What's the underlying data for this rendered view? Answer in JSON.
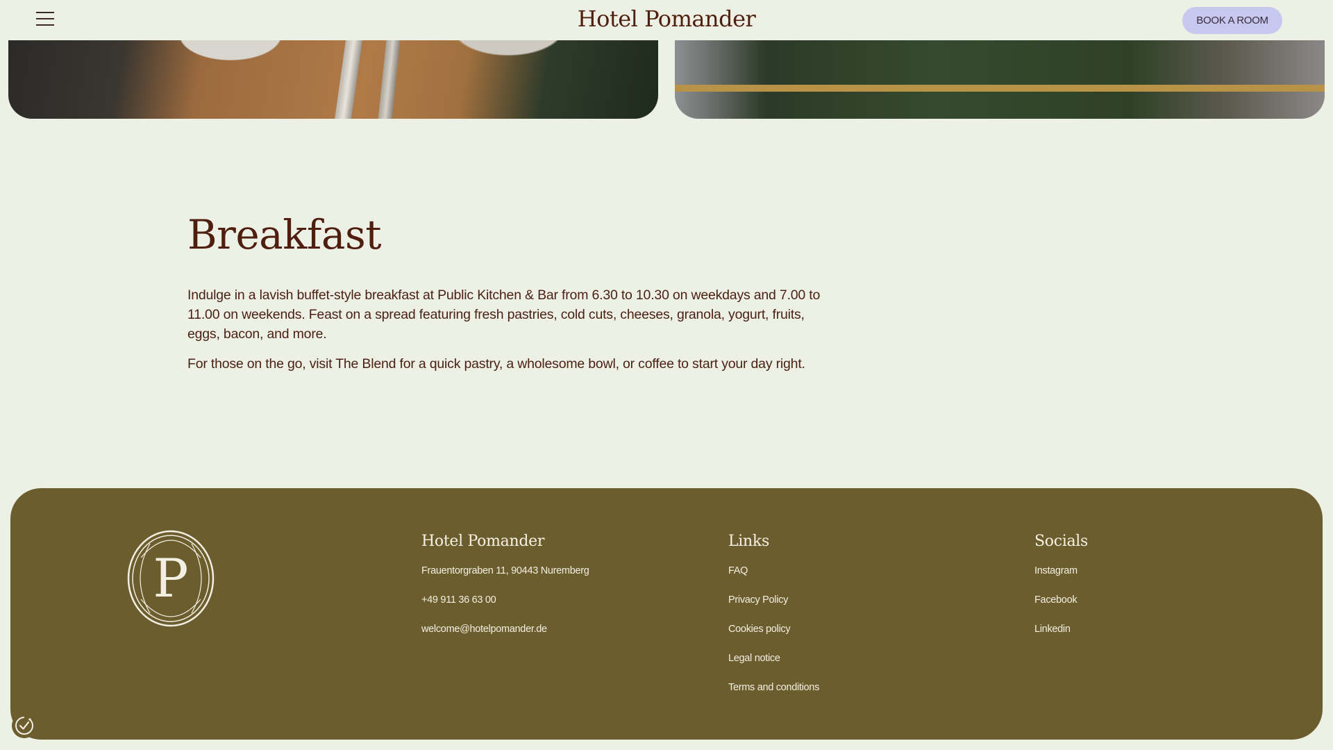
{
  "header": {
    "brand": "Hotel Pomander",
    "book_label": "BOOK A ROOM"
  },
  "section": {
    "title": "Breakfast",
    "paragraph1": "Indulge in a lavish buffet-style breakfast at Public Kitchen & Bar from 6.30 to 10.30 on weekdays and 7.00 to 11.00 on weekends. Feast on a spread featuring fresh pastries, cold cuts, cheeses, granola, yogurt, fruits, eggs, bacon, and more.",
    "paragraph2": "For those on the go, visit The Blend for a quick pastry, a wholesome bowl, or coffee to start your day right."
  },
  "footer": {
    "logo_letter": "P",
    "contact": {
      "title": "Hotel Pomander",
      "address": "Frauentorgraben 11, 90443 Nuremberg",
      "phone": "+49 911 36 63 00",
      "email": "welcome@hotelpomander.de"
    },
    "links": {
      "title": "Links",
      "items": [
        "FAQ",
        "Privacy Policy",
        "Cookies policy",
        "Legal notice",
        "Terms and conditions"
      ]
    },
    "socials": {
      "title": "Socials",
      "items": [
        "Instagram",
        "Facebook",
        "Linkedin"
      ]
    }
  },
  "colors": {
    "background": "#edf0e5",
    "brand_text": "#4f1e0f",
    "book_button": "#c6c8f0",
    "footer_bg": "#6c5d2e"
  },
  "icons": [
    "menu-icon",
    "cookie-settings-icon"
  ]
}
